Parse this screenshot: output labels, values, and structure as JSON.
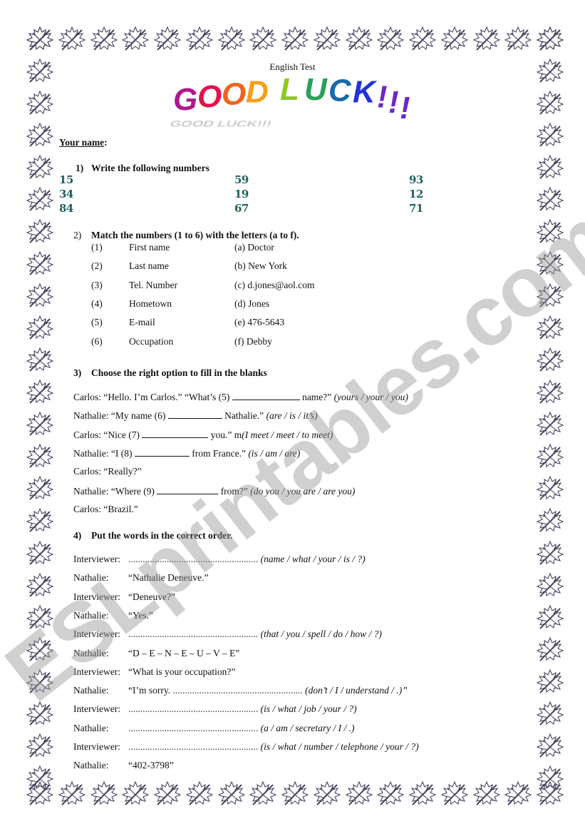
{
  "header": {
    "title": "English Test",
    "banner_text": "GOOD LUCK!!!",
    "banner_colors": [
      "#b0188c",
      "#e4104c",
      "#f0641e",
      "#f5a019",
      "#eef01a",
      "#8cc822",
      "#2aa05a",
      "#1a6aa8",
      "#2032d8",
      "#6a28c8"
    ]
  },
  "name_label": "Your name",
  "name_colon": ":",
  "section1": {
    "number": "1)",
    "heading": "Write the following numbers",
    "columns": [
      [
        "15",
        "34",
        "84"
      ],
      [
        "59",
        "19",
        "67"
      ],
      [
        "93",
        "12",
        "71"
      ]
    ],
    "number_color": "#1f5f5f"
  },
  "section2": {
    "number": "2)",
    "heading": "Match the numbers (1 to 6) with the letters (a to f).",
    "rows": [
      {
        "num": "(1)",
        "item": "First name",
        "match": "(a) Doctor"
      },
      {
        "num": "(2)",
        "item": "Last name",
        "match": "(b) New York"
      },
      {
        "num": "(3)",
        "item": "Tel. Number",
        "match": "(c) d.jones@aol.com"
      },
      {
        "num": "(4)",
        "item": "Hometown",
        "match": "(d) Jones"
      },
      {
        "num": "(5)",
        "item": "E-mail",
        "match": "(e) 476-5643"
      },
      {
        "num": "(6)",
        "item": "Occupation",
        "match": "(f) Debby"
      }
    ]
  },
  "section3": {
    "number": "3)",
    "heading": "Choose the right option to fill in the blanks",
    "lines": [
      {
        "before": "Carlos:  “Hello. I’m Carlos.”   “What’s (5) ",
        "after": " name?”    ",
        "options": "(yours / your / you)"
      },
      {
        "before": "Nathalie:  “My name (6) ",
        "after": " Nathalie.” ",
        "options": "(are / is / it’s)"
      },
      {
        "before": "Carlos:  “Nice (7) ",
        "after": " you.”  m",
        "options": "(I meet / meet / to meet)"
      },
      {
        "before": "Nathalie:  “I (8) ",
        "after": " from France.” ",
        "options": "(is / am / are)"
      },
      {
        "before": "Carlos:   “Really?”",
        "after": "",
        "options": ""
      },
      {
        "before": "Nathalie:  “Where (9) ",
        "after": " from?” ",
        "options": "(do you / you are / are you)"
      },
      {
        "before": "Carlos:   “Brazil.”",
        "after": "",
        "options": ""
      }
    ]
  },
  "section4": {
    "number": "4)",
    "heading": "Put the words in the correct order.",
    "dots": "......................................................",
    "lines": [
      {
        "speaker": "Interviewer:",
        "text": "",
        "dots": true,
        "options": "(name / what / your / is / ?)"
      },
      {
        "speaker": "Nathalie:",
        "text": "“Nathalie Deneuve.”",
        "dots": false,
        "options": ""
      },
      {
        "speaker": "Interviewer:",
        "text": "“Deneuve?”",
        "dots": false,
        "options": ""
      },
      {
        "speaker": "Nathalie:",
        "text": "“Yes.”",
        "dots": false,
        "options": ""
      },
      {
        "speaker": "Interviewer:",
        "text": "",
        "dots": true,
        "options": "(that / you / spell / do / how / ?)"
      },
      {
        "speaker": "Nathalie:",
        "text": "“D – E – N – E – U – V – E”",
        "dots": false,
        "options": ""
      },
      {
        "speaker": "Interviewer:",
        "text": "“What is your occupation?”",
        "dots": false,
        "options": ""
      },
      {
        "speaker": "Nathalie:",
        "text": "“I’m sorry. ",
        "dots": true,
        "options": "(don’t / I / understand / .)”"
      },
      {
        "speaker": "Interviewer:",
        "text": "",
        "dots": true,
        "options": "(is / what / job / your / ?)"
      },
      {
        "speaker": "Nathalie:",
        "text": "",
        "dots": true,
        "options": "(a / am / secretary / I / .)"
      },
      {
        "speaker": "Interviewer:",
        "text": "",
        "dots": true,
        "options": "(is / what / number / telephone / your / ?)"
      },
      {
        "speaker": "Nathalie:",
        "text": "“402-3798”",
        "dots": false,
        "options": ""
      }
    ]
  },
  "watermark": "ESLprintables.com",
  "border_color": "#4a4460"
}
